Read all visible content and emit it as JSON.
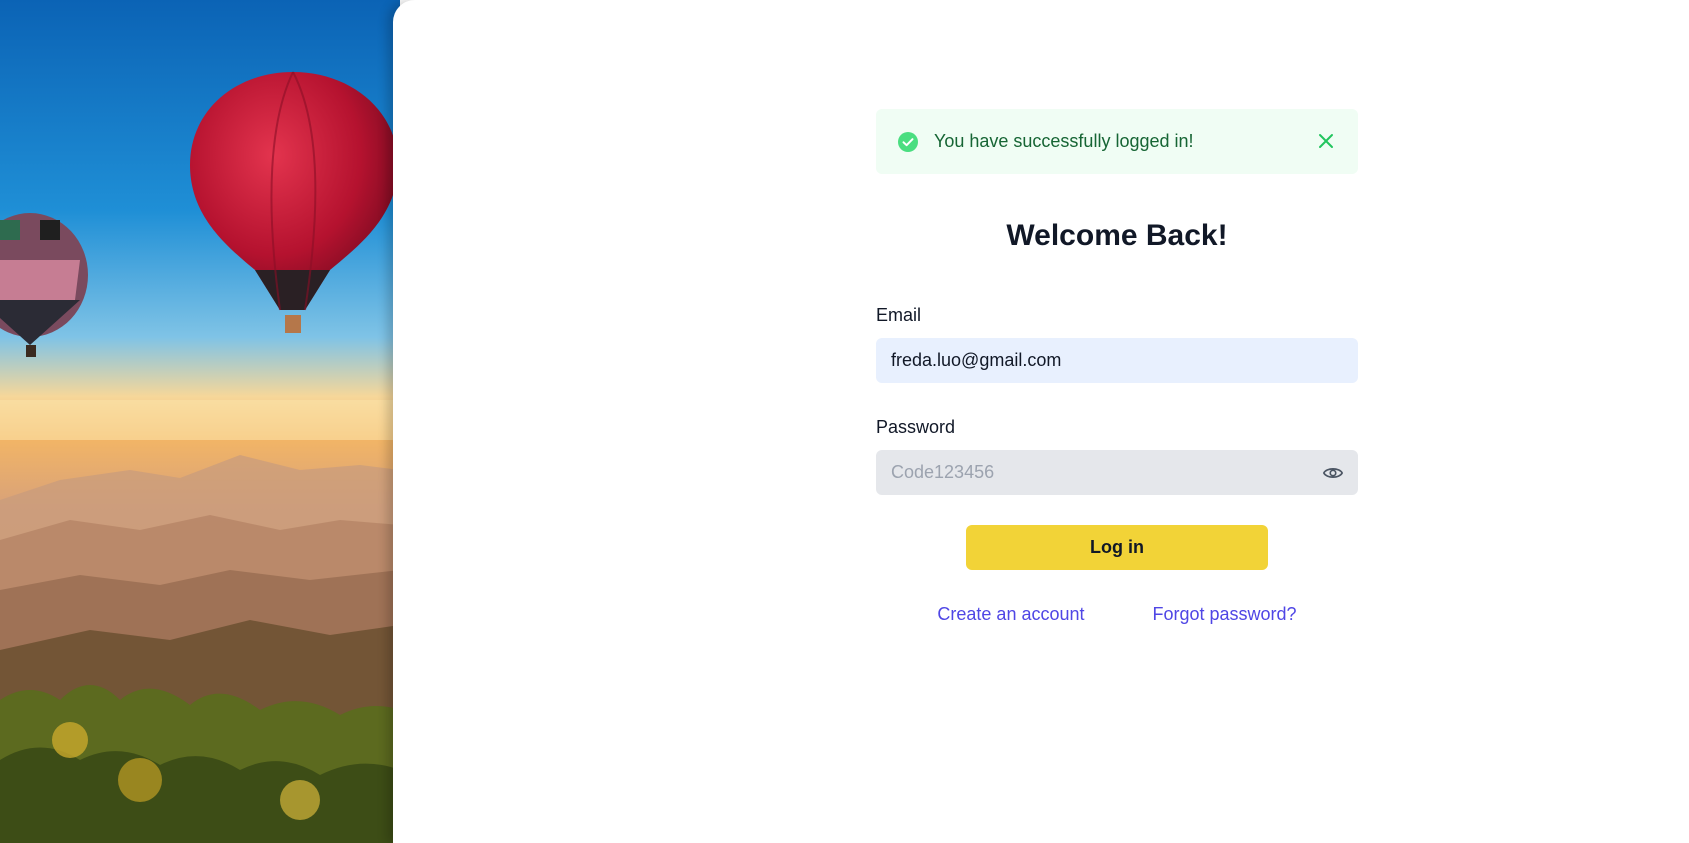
{
  "alert": {
    "message": "You have successfully logged in!",
    "icon": "check-circle-icon",
    "close_icon": "close-icon",
    "color": "#166534",
    "background": "#f0fdf4"
  },
  "form": {
    "title": "Welcome Back!",
    "email_label": "Email",
    "email_value": "freda.luo@gmail.com",
    "password_label": "Password",
    "password_value": "Code123456",
    "password_toggle_icon": "eye-icon",
    "login_label": "Log in",
    "login_color": "#f2d337"
  },
  "links": {
    "create_account": "Create an account",
    "forgot_password": "Forgot password?",
    "color": "#4f46e5"
  },
  "hero": {
    "image": "hot-air-balloons-over-misty-mountains"
  }
}
